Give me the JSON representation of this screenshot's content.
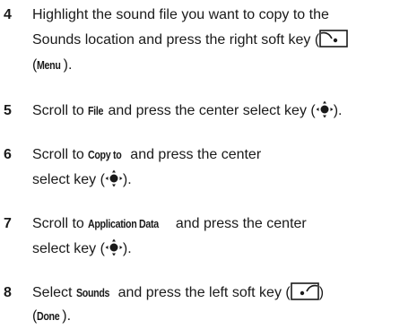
{
  "steps": [
    {
      "number": "4",
      "line1": "Highlight the sound file you want to copy to the",
      "line2_pre": "Sounds location and press the right soft key (",
      "right_soft_key_icon": "right-soft-key-icon",
      "line3_kw": "Menu",
      "line3_post": ")."
    },
    {
      "number": "5",
      "pre": "Scroll to ",
      "kw": "File",
      "post": " and press the center select key (",
      "nav_icon": "center-select-key-icon",
      "end": ")."
    },
    {
      "number": "6",
      "pre": "Scroll to  ",
      "kw": "Copy to",
      "post": " and press the center",
      "line2_pre": "select key (",
      "nav_icon": "center-select-key-icon",
      "line2_end": ")."
    },
    {
      "number": "7",
      "pre": "Scroll to  ",
      "kw": "Application Data",
      "post": " and press the center",
      "line2_pre": "select key (",
      "nav_icon": "center-select-key-icon",
      "line2_end": ")."
    },
    {
      "number": "8",
      "pre": "Select  ",
      "kw": "Sounds",
      "post": " and press the left soft key (",
      "left_soft_key_icon": "left-soft-key-icon",
      "post2": ")",
      "line2_kw": "Done",
      "line2_end": ")."
    }
  ],
  "paren_open": "(",
  "colors": {
    "text": "#1a1a1a",
    "background": "#ffffff"
  }
}
